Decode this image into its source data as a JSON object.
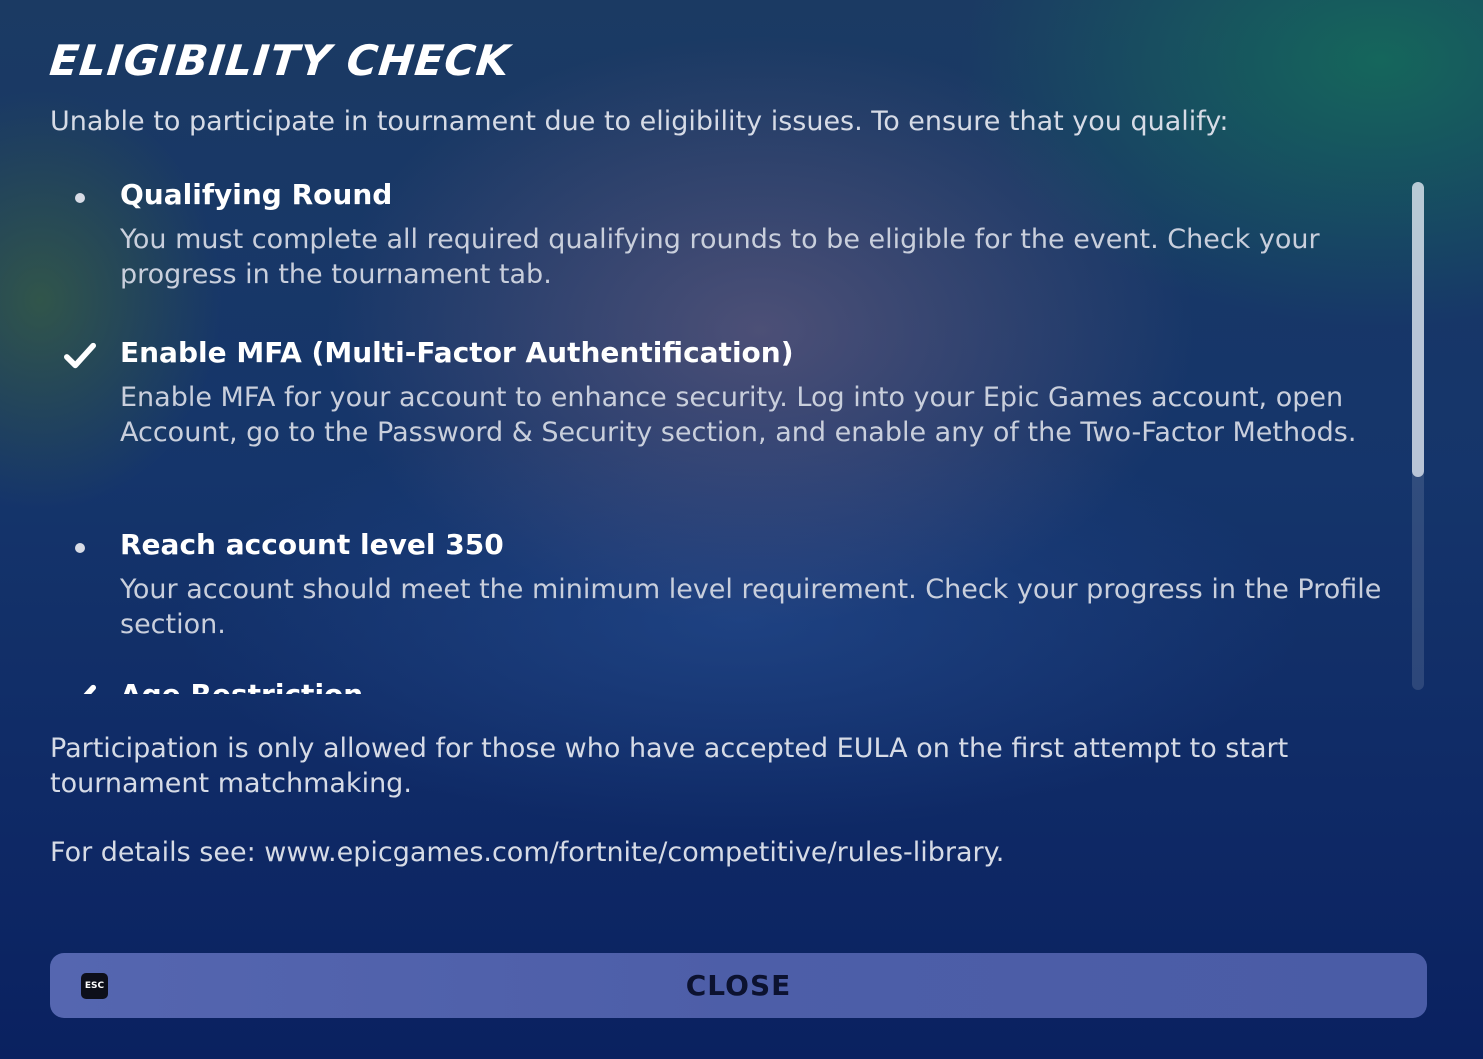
{
  "title": "ELIGIBILITY CHECK",
  "intro": "Unable to participate in tournament due to eligibility issues. To ensure that you qualify:",
  "requirements": [
    {
      "title": "Qualifying Round",
      "description": "You must complete all required qualifying rounds to be eligible for the event. Check your progress in the tournament tab.",
      "status": "bullet"
    },
    {
      "title": "Enable MFA (Multi-Factor Authentification)",
      "description": "Enable MFA for your account to enhance security. Log into your Epic Games account, open Account, go to the Password & Security section, and enable any of the Two-Factor Methods.",
      "status": "checkmark"
    },
    {
      "title": "Reach account level 350",
      "description": "Your account should meet the minimum level requirement. Check your progress in the Profile section.",
      "status": "bullet"
    },
    {
      "title": "Age Restriction",
      "description": "",
      "status": "checkmark"
    }
  ],
  "footer_note": "Participation is only allowed for those who have accepted EULA on the first attempt to start tournament matchmaking.",
  "details": "For details see: www.epicgames.com/fortnite/competitive/rules-library.",
  "close_button": {
    "key_hint": "ESC",
    "label": "CLOSE"
  },
  "colors": {
    "background": "#15356b",
    "close_button": "#4d5ea8",
    "text_primary": "#ffffff",
    "text_secondary": "#c9cfdc"
  }
}
